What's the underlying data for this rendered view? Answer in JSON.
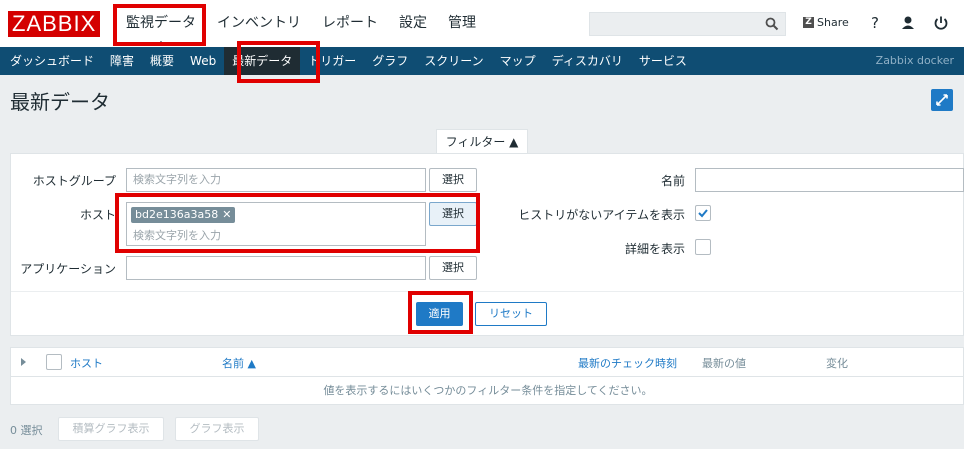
{
  "header": {
    "logo": "ZABBIX",
    "nav": [
      "監視データ",
      "インベントリ",
      "レポート",
      "設定",
      "管理"
    ],
    "search_placeholder": "",
    "share_label": "Share",
    "help": "?"
  },
  "subnav": {
    "items": [
      "ダッシュボード",
      "障害",
      "概要",
      "Web",
      "最新データ",
      "トリガー",
      "グラフ",
      "スクリーン",
      "マップ",
      "ディスカバリ",
      "サービス"
    ],
    "active": "最新データ",
    "server_name": "Zabbix docker"
  },
  "page": {
    "title": "最新データ"
  },
  "filter": {
    "tab_label": "フィルター ▲",
    "host_group_label": "ホストグループ",
    "host_group_placeholder": "検索文字列を入力",
    "host_label": "ホスト",
    "host_tag": "bd2e136a3a58",
    "host_placeholder": "検索文字列を入力",
    "application_label": "アプリケーション",
    "application_value": "",
    "select_label": "選択",
    "name_label": "名前",
    "name_value": "",
    "show_without_history_label": "ヒストリがないアイテムを表示",
    "show_without_history_checked": true,
    "show_details_label": "詳細を表示",
    "show_details_checked": false,
    "apply_label": "適用",
    "reset_label": "リセット"
  },
  "table": {
    "columns": [
      "ホスト",
      "名前 ▲",
      "最新のチェック時刻",
      "最新の値",
      "変化"
    ],
    "empty_message": "値を表示するにはいくつかのフィルター条件を指定してください。"
  },
  "footer": {
    "selected_count": "0 選択",
    "stacked_graph_label": "積算グラフ表示",
    "graph_label": "グラフ表示"
  },
  "colors": {
    "brand": "#d40000",
    "subnav_bg": "#0f4d73",
    "accent": "#1f7ac6",
    "highlight": "#e00000"
  }
}
